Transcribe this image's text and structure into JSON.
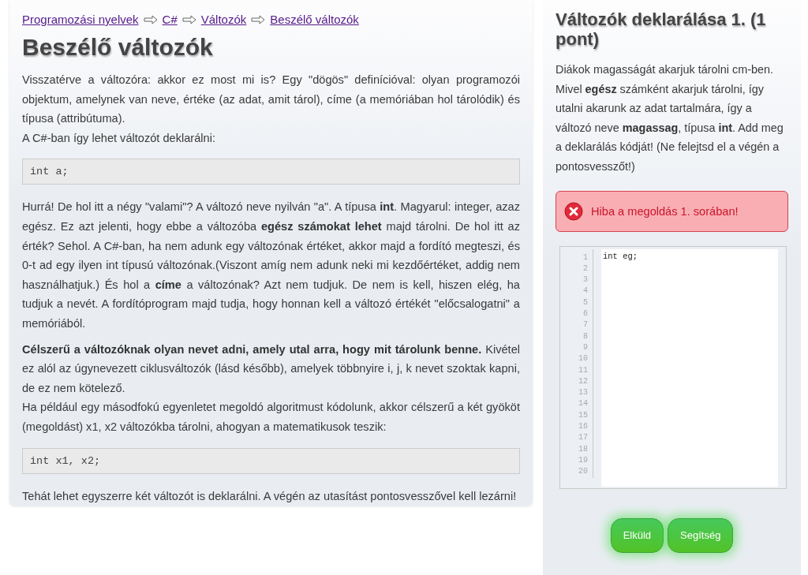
{
  "breadcrumbs": [
    {
      "label": "Programozási nyelvek"
    },
    {
      "label": "C#"
    },
    {
      "label": "Változók"
    },
    {
      "label": "Beszélő változók"
    }
  ],
  "title": "Beszélő változók",
  "blocks": [
    {
      "kind": "para",
      "lines": [
        "Visszatérve a változóra: akkor ez most mi is? Egy \"dögös\" definícióval: olyan programozói objektum, amelynek van neve, értéke (az adat, amit tárol), címe (a memóriában hol tárolódik) és típusa (attribútuma).",
        "A C#-ban így lehet változót deklarálni:"
      ]
    },
    {
      "kind": "code",
      "text": "int a;"
    },
    {
      "kind": "para",
      "lines": [
        "Hurrá! De hol itt a négy \"valami\"? A változó neve nyilván \"a\". A típusa **int**. Magyarul: integer, azaz egész. Ez azt jelenti, hogy ebbe a változóba **egész számokat lehet** majd tárolni. De hol itt az érték? Sehol. A C#-ban, ha nem adunk egy változónak értéket, akkor majd a fordító megteszi, és 0-t ad egy ilyen int típusú változónak.(Viszont amíg nem adunk neki mi kezdőértéket, addig nem használhatjuk.) És hol a **címe** a változónak? Azt nem tudjuk. De nem is kell, hiszen elég, ha tudjuk a nevét. A fordítóprogram majd tudja, hogy honnan kell a változó értékét \"előcsalogatni\" a memóriából."
      ]
    },
    {
      "kind": "para",
      "lines": [
        "**Célszerű a változóknak olyan nevet adni, amely utal arra, hogy mit tárolunk benne.** Kivétel ez alól az úgynevezett ciklusváltozók (lásd később), amelyek többnyire i, j, k nevet szoktak kapni, de ez nem kötelező.",
        "Ha például egy másodfokú egyenletet megoldó algoritmust kódolunk, akkor célszerű a két gyököt (megoldást) x1, x2 változókba tárolni, ahogyan a matematikusok teszik:"
      ]
    },
    {
      "kind": "code",
      "text": "int x1, x2;"
    },
    {
      "kind": "para",
      "lines": [
        "Tehát lehet egyszerre két változót is deklarálni. A végén az utasítást pontosvesszővel kell lezárni!"
      ]
    }
  ],
  "task": {
    "title": "Változók deklarálása 1. (1 pont)",
    "description": "Diákok magasságát akarjuk tárolni cm-ben. Mivel **egész** számként akarjuk tárolni, így utalni akarunk az adat tartalmára, így a változó neve **magassag**, típusa **int**. Add meg a deklarálás kódját! (Ne felejtsd el a végén a pontosvesszőt!)",
    "error": "Hiba a megoldás 1. sorában!",
    "editor": {
      "value": "int eg;",
      "line_numbers": [
        "1",
        "2",
        "3",
        "4",
        "5",
        "6",
        "7",
        "8",
        "9",
        "10",
        "11",
        "12",
        "13",
        "14",
        "15",
        "16",
        "17",
        "18",
        "19",
        "20"
      ]
    },
    "buttons": [
      "Elküld",
      "Segítség"
    ]
  }
}
